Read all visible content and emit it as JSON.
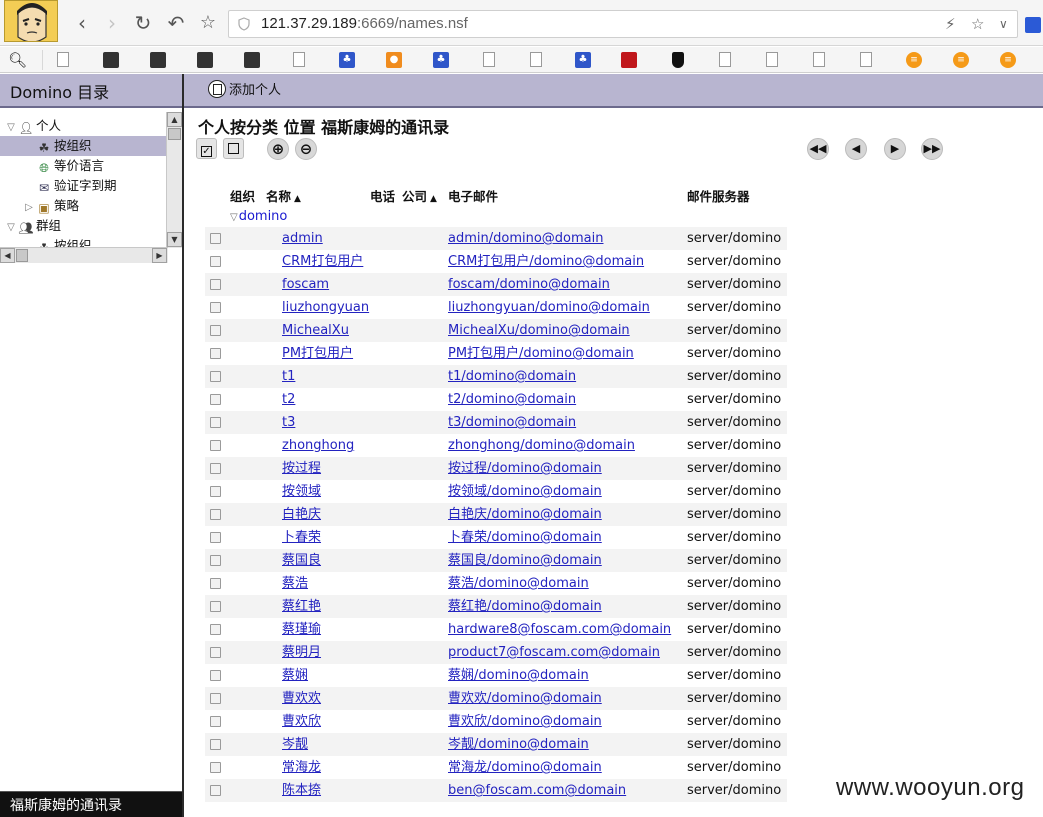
{
  "browser": {
    "url_host": "121.37.29.189",
    "url_rest": ":6669/names.nsf"
  },
  "left_pane": {
    "title": "Domino 目录",
    "tree": [
      {
        "label": "个人",
        "level": 0,
        "expanded": true,
        "icon": "person-icon",
        "selected": false
      },
      {
        "label": "按组织",
        "level": 1,
        "expanded": false,
        "icon": "org-icon",
        "selected": true
      },
      {
        "label": "等价语言",
        "level": 1,
        "expanded": false,
        "icon": "globe-icon",
        "selected": false
      },
      {
        "label": "验证字到期",
        "level": 1,
        "expanded": false,
        "icon": "certificate-icon",
        "selected": false
      },
      {
        "label": "策略",
        "level": 1,
        "expanded": false,
        "icon": "policy-icon",
        "selected": false,
        "collapsed": true
      },
      {
        "label": "群组",
        "level": 0,
        "expanded": true,
        "icon": "group-icon",
        "selected": false
      },
      {
        "label": "按组织",
        "level": 1,
        "expanded": false,
        "icon": "org-icon",
        "selected": false
      }
    ],
    "footer": "福斯康姆的通讯录"
  },
  "action_bar": {
    "add_person": "添加个人"
  },
  "view": {
    "title": "个人按分类 位置 福斯康姆的通讯录",
    "columns": {
      "org": "组织",
      "name": "名称",
      "phone": "电话",
      "company": "公司",
      "email": "电子邮件",
      "mail_server": "邮件服务器"
    },
    "category": "domino",
    "rows": [
      {
        "name": "admin",
        "email": "admin/domino@domain",
        "server": "server/domino"
      },
      {
        "name": "CRM打包用户",
        "email": "CRM打包用户/domino@domain",
        "server": "server/domino"
      },
      {
        "name": "foscam",
        "email": "foscam/domino@domain",
        "server": "server/domino"
      },
      {
        "name": "liuzhongyuan",
        "email": "liuzhongyuan/domino@domain",
        "server": "server/domino"
      },
      {
        "name": "MichealXu",
        "email": "MichealXu/domino@domain",
        "server": "server/domino"
      },
      {
        "name": "PM打包用户",
        "email": "PM打包用户/domino@domain",
        "server": "server/domino"
      },
      {
        "name": "t1",
        "email": "t1/domino@domain",
        "server": "server/domino"
      },
      {
        "name": "t2",
        "email": "t2/domino@domain",
        "server": "server/domino"
      },
      {
        "name": "t3",
        "email": "t3/domino@domain",
        "server": "server/domino"
      },
      {
        "name": "zhonghong",
        "email": "zhonghong/domino@domain",
        "server": "server/domino"
      },
      {
        "name": "按过程",
        "email": "按过程/domino@domain",
        "server": "server/domino"
      },
      {
        "name": "按领域",
        "email": "按领域/domino@domain",
        "server": "server/domino"
      },
      {
        "name": "白艳庆",
        "email": "白艳庆/domino@domain",
        "server": "server/domino"
      },
      {
        "name": "卜春荣",
        "email": "卜春荣/domino@domain",
        "server": "server/domino"
      },
      {
        "name": "蔡国良",
        "email": "蔡国良/domino@domain",
        "server": "server/domino"
      },
      {
        "name": "蔡浩",
        "email": "蔡浩/domino@domain",
        "server": "server/domino"
      },
      {
        "name": "蔡红艳",
        "email": "蔡红艳/domino@domain",
        "server": "server/domino"
      },
      {
        "name": "蔡瑾瑜",
        "email": "hardware8@foscam.com@domain",
        "server": "server/domino"
      },
      {
        "name": "蔡明月",
        "email": "product7@foscam.com@domain",
        "server": "server/domino"
      },
      {
        "name": "蔡娴",
        "email": "蔡娴/domino@domain",
        "server": "server/domino"
      },
      {
        "name": "曹欢欢",
        "email": "曹欢欢/domino@domain",
        "server": "server/domino"
      },
      {
        "name": "曹欢欣",
        "email": "曹欢欣/domino@domain",
        "server": "server/domino"
      },
      {
        "name": "岑靓",
        "email": "岑靓/domino@domain",
        "server": "server/domino"
      },
      {
        "name": "常海龙",
        "email": "常海龙/domino@domain",
        "server": "server/domino"
      },
      {
        "name": "陈本捺",
        "email": "ben@foscam.com@domain",
        "server": "server/domino"
      }
    ]
  },
  "watermark": "www.wooyun.org"
}
